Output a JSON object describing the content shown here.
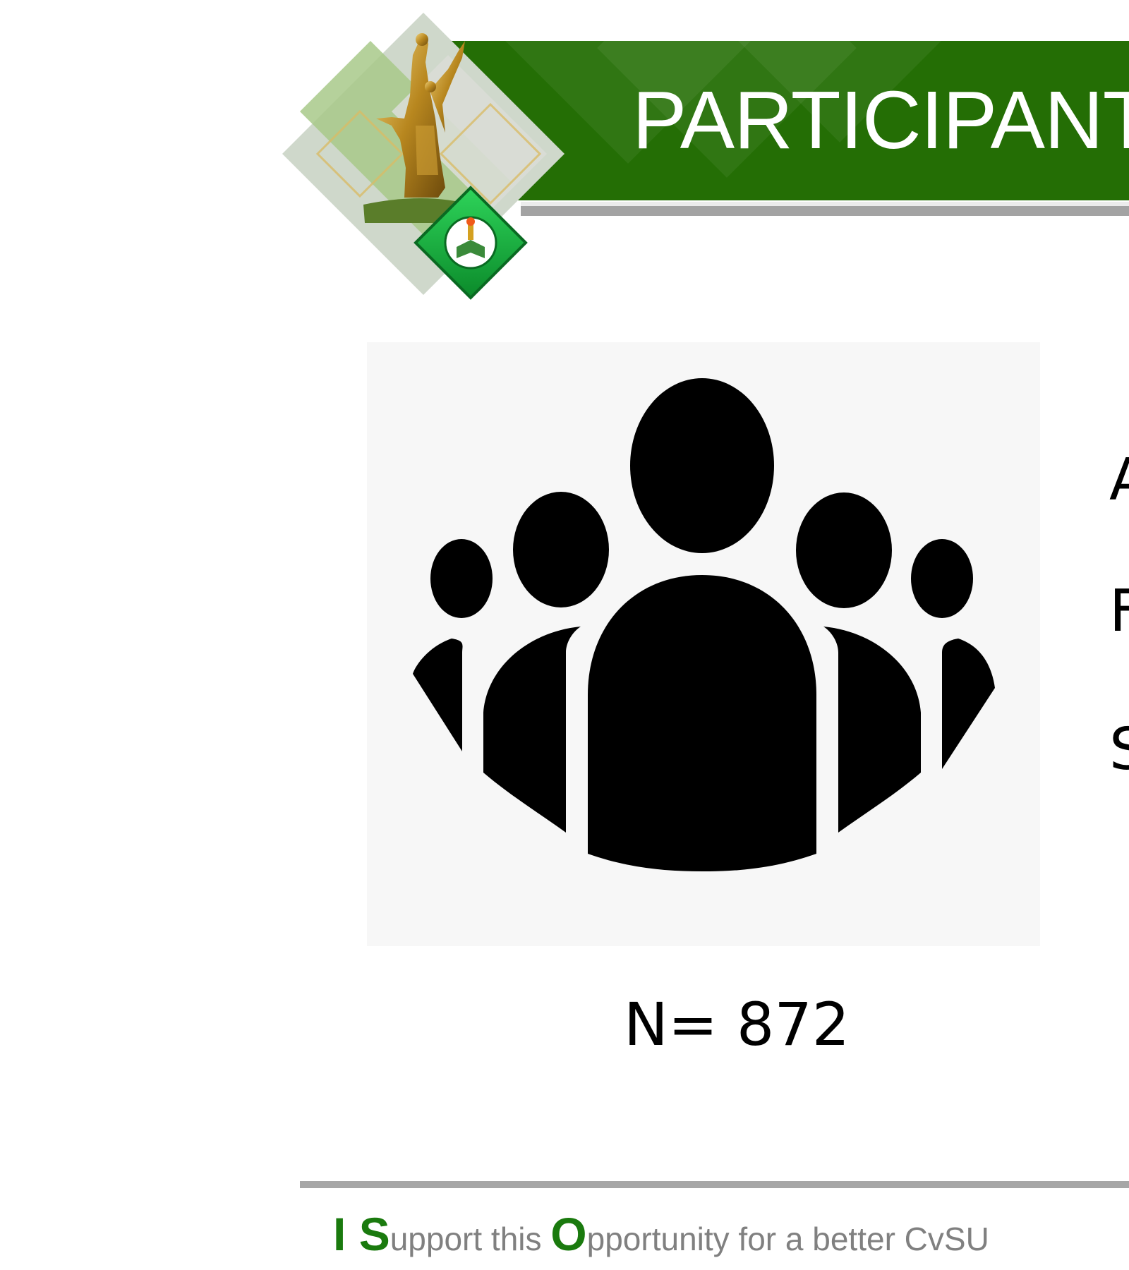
{
  "slide": {
    "title": "PARTICIPANT",
    "count_label": "N= 872",
    "side_list": [
      "A",
      "F",
      "S"
    ],
    "footer": {
      "parts": [
        {
          "text": "I ",
          "emphasis": true
        },
        {
          "text": "S",
          "emphasis": true
        },
        {
          "text": "upport this ",
          "emphasis": false
        },
        {
          "text": "O",
          "emphasis": true
        },
        {
          "text": "pportunity for a better CvSU",
          "emphasis": false
        }
      ]
    }
  },
  "colors": {
    "banner_green": "#246e05",
    "accent_green": "#1a7a0e",
    "gray_rule": "#a3a3a3",
    "footer_text": "#808080"
  },
  "icons": {
    "emblem": "university-monument-logo",
    "seal": "cvsu-seal-icon",
    "people": "group-of-people-icon"
  }
}
